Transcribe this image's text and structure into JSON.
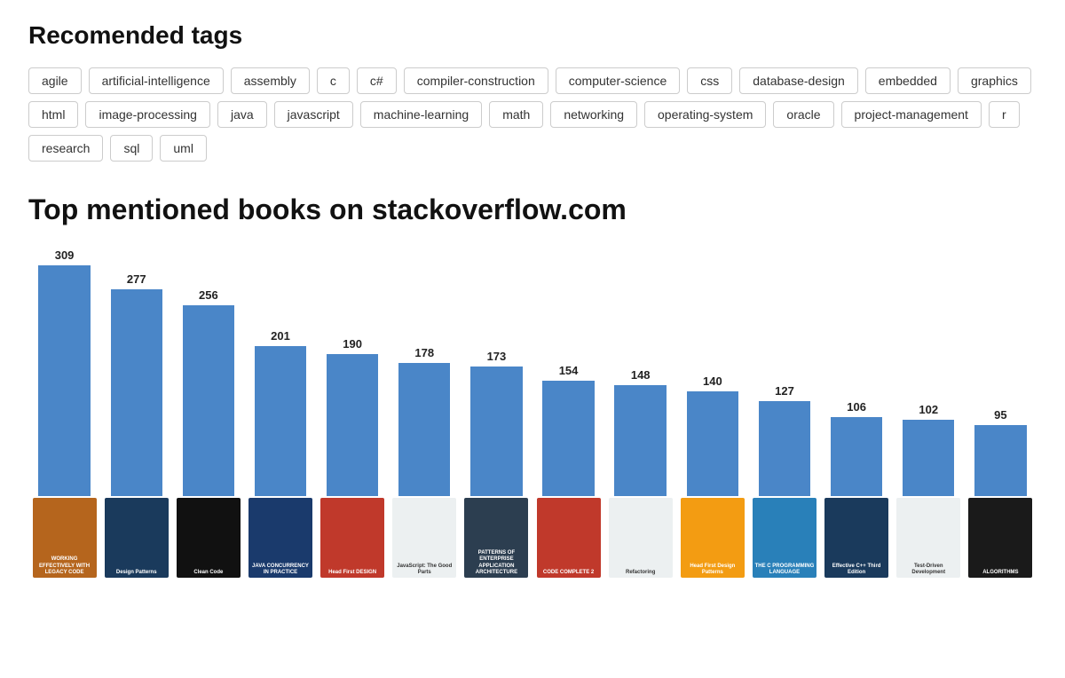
{
  "recommended_tags": {
    "title": "Recomended tags",
    "tags": [
      "agile",
      "artificial-intelligence",
      "assembly",
      "c",
      "c#",
      "compiler-construction",
      "computer-science",
      "css",
      "database-design",
      "embedded",
      "graphics",
      "html",
      "image-processing",
      "java",
      "javascript",
      "machine-learning",
      "math",
      "networking",
      "operating-system",
      "oracle",
      "project-management",
      "r",
      "research",
      "sql",
      "uml"
    ]
  },
  "books_chart": {
    "title": "Top mentioned books on stackoverflow.com",
    "bars": [
      {
        "value": 309,
        "color": "#4a86c8",
        "book_bg": "#b5651d",
        "book_label": "WORKING\nEFFECTIVELY\nWITH\nLEGACY CODE"
      },
      {
        "value": 277,
        "color": "#4a86c8",
        "book_bg": "#1a3a5c",
        "book_label": "Design\nPatterns"
      },
      {
        "value": 256,
        "color": "#4a86c8",
        "book_bg": "#111",
        "book_label": "Clean\nCode"
      },
      {
        "value": 201,
        "color": "#4a86c8",
        "book_bg": "#1a3a6c",
        "book_label": "JAVA\nCONCURRENCY\nIN PRACTICE"
      },
      {
        "value": 190,
        "color": "#4a86c8",
        "book_bg": "#c0392b",
        "book_label": "Head First\nDESIGN"
      },
      {
        "value": 178,
        "color": "#4a86c8",
        "book_bg": "#ecf0f1",
        "book_label": "JavaScript:\nThe Good Parts"
      },
      {
        "value": 173,
        "color": "#4a86c8",
        "book_bg": "#2c3e50",
        "book_label": "PATTERNS OF\nENTERPRISE\nAPPLICATION\nARCHITECTURE"
      },
      {
        "value": 154,
        "color": "#4a86c8",
        "book_bg": "#c0392b",
        "book_label": "CODE\nCOMPLETE 2"
      },
      {
        "value": 148,
        "color": "#4a86c8",
        "book_bg": "#ecf0f1",
        "book_label": "Refactoring"
      },
      {
        "value": 140,
        "color": "#4a86c8",
        "book_bg": "#f39c12",
        "book_label": "Head First\nDesign\nPatterns"
      },
      {
        "value": 127,
        "color": "#4a86c8",
        "book_bg": "#2980b9",
        "book_label": "THE C\nPROGRAMMING\nLANGUAGE"
      },
      {
        "value": 106,
        "color": "#4a86c8",
        "book_bg": "#1a3a5c",
        "book_label": "Effective C++\nThird Edition"
      },
      {
        "value": 102,
        "color": "#4a86c8",
        "book_bg": "#ecf0f1",
        "book_label": "Test-Driven\nDevelopment"
      },
      {
        "value": 95,
        "color": "#4a86c8",
        "book_bg": "#1a1a1a",
        "book_label": "ALGORITHMS"
      }
    ],
    "max_value": 309
  }
}
